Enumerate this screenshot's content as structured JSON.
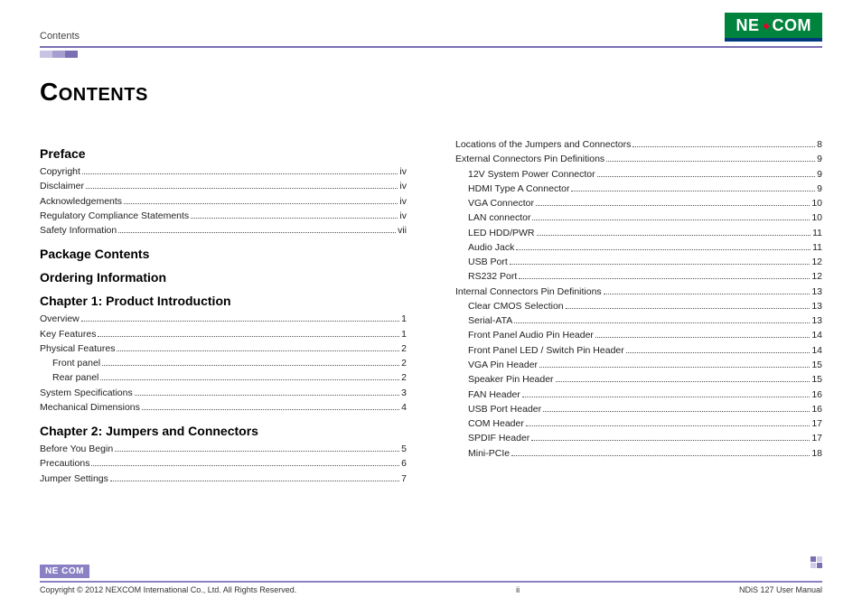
{
  "header": {
    "section_label": "Contents",
    "logo_pre": "NE",
    "logo_mid": "X",
    "logo_post": "COM"
  },
  "title": "Contents",
  "left": {
    "sections": [
      {
        "heading": "Preface",
        "entries": [
          {
            "label": "Copyright",
            "page": "iv",
            "indent": 0
          },
          {
            "label": "Disclaimer",
            "page": "iv",
            "indent": 0
          },
          {
            "label": "Acknowledgements",
            "page": "iv",
            "indent": 0
          },
          {
            "label": "Regulatory Compliance Statements",
            "page": "iv",
            "indent": 0
          },
          {
            "label": "Safety Information",
            "page": "vii",
            "indent": 0
          }
        ]
      },
      {
        "heading": "Package Contents",
        "entries": []
      },
      {
        "heading": "Ordering Information",
        "entries": []
      },
      {
        "heading": "Chapter 1: Product Introduction",
        "entries": [
          {
            "label": "Overview",
            "page": "1",
            "indent": 0
          },
          {
            "label": "Key Features",
            "page": "1",
            "indent": 0
          },
          {
            "label": "Physical Features",
            "page": "2",
            "indent": 0
          },
          {
            "label": "Front panel",
            "page": "2",
            "indent": 1
          },
          {
            "label": "Rear panel",
            "page": "2",
            "indent": 1
          },
          {
            "label": "System Specifications",
            "page": "3",
            "indent": 0
          },
          {
            "label": "Mechanical Dimensions",
            "page": "4",
            "indent": 0
          }
        ]
      },
      {
        "heading": "Chapter 2: Jumpers and Connectors",
        "entries": [
          {
            "label": "Before You Begin",
            "page": "5",
            "indent": 0
          },
          {
            "label": "Precautions",
            "page": "6",
            "indent": 0
          },
          {
            "label": "Jumper Settings",
            "page": "7",
            "indent": 0
          }
        ]
      }
    ]
  },
  "right": {
    "entries": [
      {
        "label": "Locations of the Jumpers and Connectors",
        "page": "8",
        "indent": 0
      },
      {
        "label": "External Connectors Pin Definitions",
        "page": "9",
        "indent": 0
      },
      {
        "label": "12V System Power Connector",
        "page": "9",
        "indent": 1
      },
      {
        "label": "HDMI Type A Connector",
        "page": "9",
        "indent": 1
      },
      {
        "label": "VGA Connector",
        "page": "10",
        "indent": 1
      },
      {
        "label": "LAN connector",
        "page": "10",
        "indent": 1
      },
      {
        "label": "LED HDD/PWR",
        "page": "11",
        "indent": 1
      },
      {
        "label": "Audio Jack",
        "page": "11",
        "indent": 1
      },
      {
        "label": "USB Port",
        "page": "12",
        "indent": 1
      },
      {
        "label": "RS232 Port",
        "page": "12",
        "indent": 1
      },
      {
        "label": "Internal Connectors Pin Definitions",
        "page": "13",
        "indent": 0
      },
      {
        "label": "Clear CMOS Selection",
        "page": "13",
        "indent": 1
      },
      {
        "label": "Serial-ATA",
        "page": "13",
        "indent": 1
      },
      {
        "label": "Front Panel Audio Pin Header",
        "page": "14",
        "indent": 1
      },
      {
        "label": "Front Panel LED / Switch Pin Header",
        "page": "14",
        "indent": 1
      },
      {
        "label": "VGA Pin Header",
        "page": "15",
        "indent": 1
      },
      {
        "label": "Speaker Pin Header",
        "page": "15",
        "indent": 1
      },
      {
        "label": "FAN Header",
        "page": "16",
        "indent": 1
      },
      {
        "label": "USB Port Header",
        "page": "16",
        "indent": 1
      },
      {
        "label": "COM Header",
        "page": "17",
        "indent": 1
      },
      {
        "label": "SPDIF Header",
        "page": "17",
        "indent": 1
      },
      {
        "label": "Mini-PCIe",
        "page": "18",
        "indent": 1
      }
    ]
  },
  "footer": {
    "logo_text": "NE COM",
    "copyright": "Copyright © 2012 NEXCOM International Co., Ltd. All Rights Reserved.",
    "page_number": "ii",
    "doc_title": "NDiS 127 User Manual"
  }
}
